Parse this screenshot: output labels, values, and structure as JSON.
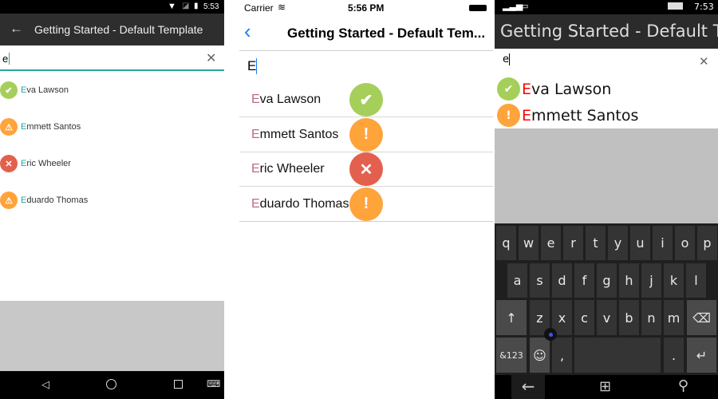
{
  "colors": {
    "success": "#a5cf5a",
    "warning": "#ffa33b",
    "error": "#e4604e",
    "android_accent": "#26a69a",
    "ios_highlight": "#c06a82",
    "win_highlight": "#ff0000",
    "ios_blue": "#1a7cf5"
  },
  "android": {
    "status_time": "5:53",
    "title": "Getting Started - Default Template",
    "back_icon": "arrow-left-icon",
    "search_value": "e",
    "clear_icon": "close-icon",
    "items": [
      {
        "highlight": "E",
        "rest": "va Lawson",
        "status": "success",
        "icon": "✔"
      },
      {
        "highlight": "E",
        "rest": "mmett Santos",
        "status": "warning",
        "icon": "⚠"
      },
      {
        "highlight": "E",
        "rest": "ric Wheeler",
        "status": "error",
        "icon": "✕"
      },
      {
        "highlight": "E",
        "rest": "duardo Thomas",
        "status": "warning",
        "icon": "⚠"
      }
    ]
  },
  "ios": {
    "carrier": "Carrier",
    "status_time": "5:56 PM",
    "title": "Getting Started - Default Tem...",
    "search_value": "E",
    "items": [
      {
        "highlight": "E",
        "rest": "va Lawson",
        "status": "success",
        "icon": "✔"
      },
      {
        "highlight": "E",
        "rest": "mmett Santos",
        "status": "warning",
        "icon": "!"
      },
      {
        "highlight": "E",
        "rest": "ric Wheeler",
        "status": "error",
        "icon": "✕"
      },
      {
        "highlight": "E",
        "rest": "duardo Thomas",
        "status": "warning",
        "icon": "!"
      }
    ]
  },
  "win": {
    "status_time": "7:53",
    "title": "Getting Started - Default Template",
    "search_value": "e",
    "items": [
      {
        "highlight": "E",
        "rest": "va Lawson",
        "status": "success",
        "icon": "✔"
      },
      {
        "highlight": "E",
        "rest": "mmett Santos",
        "status": "warning",
        "icon": "!"
      }
    ],
    "keyboard": {
      "row1": [
        "q",
        "w",
        "e",
        "r",
        "t",
        "y",
        "u",
        "i",
        "o",
        "p"
      ],
      "row2": [
        "a",
        "s",
        "d",
        "f",
        "g",
        "h",
        "j",
        "k",
        "l"
      ],
      "row3": [
        "z",
        "x",
        "c",
        "v",
        "b",
        "n",
        "m"
      ],
      "shift": "↑",
      "backspace": "⌫",
      "numbers": "&123",
      "emoji": "☺",
      "comma": ",",
      "period": ".",
      "enter": "↵"
    }
  }
}
